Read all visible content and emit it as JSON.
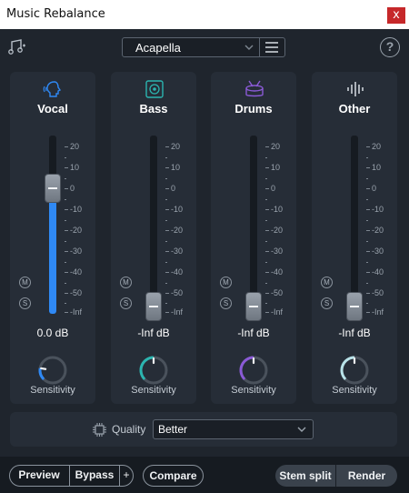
{
  "window": {
    "title": "Music Rebalance",
    "close_label": "x"
  },
  "toolbar": {
    "preset": "Acapella",
    "help": "?"
  },
  "scale_labels": [
    "20",
    "10",
    "0",
    "-10",
    "-20",
    "-30",
    "-40",
    "-50",
    "-Inf"
  ],
  "mute_label": "M",
  "solo_label": "S",
  "sensitivity_label": "Sensitivity",
  "panels": [
    {
      "name": "Vocal",
      "db": "0.0 dB",
      "gain_db": 0,
      "knob_color": "#2f89f5",
      "icon": "vocal-head-icon",
      "sensitivity": 0.2
    },
    {
      "name": "Bass",
      "db": "-Inf dB",
      "gain_db": "-Inf",
      "knob_color": "#2bb5b0",
      "icon": "speaker-icon",
      "sensitivity": 0.5
    },
    {
      "name": "Drums",
      "db": "-Inf dB",
      "gain_db": "-Inf",
      "knob_color": "#8a5ad6",
      "icon": "drum-icon",
      "sensitivity": 0.5
    },
    {
      "name": "Other",
      "db": "-Inf dB",
      "gain_db": "-Inf",
      "knob_color": "#b8e2e8",
      "icon": "waveform-icon",
      "sensitivity": 0.5
    }
  ],
  "quality": {
    "label": "Quality",
    "value": "Better"
  },
  "footer": {
    "preview": "Preview",
    "bypass": "Bypass",
    "plus": "+",
    "compare": "Compare",
    "stem_split": "Stem split",
    "render": "Render"
  },
  "colors": {
    "accent": "#2f89f5"
  }
}
